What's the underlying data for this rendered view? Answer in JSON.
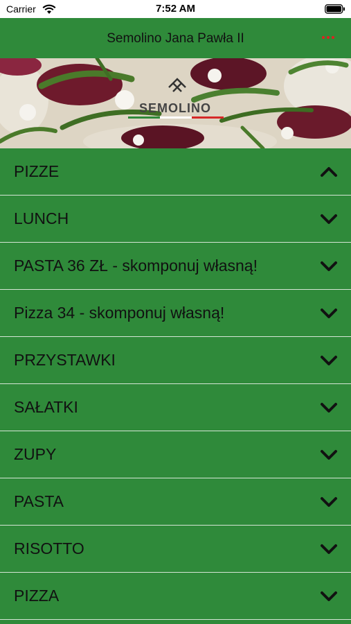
{
  "status_bar": {
    "carrier": "Carrier",
    "time": "7:52 AM"
  },
  "nav": {
    "title": "Semolino Jana Pawła II",
    "more_icon": "ellipsis-icon",
    "more_color": "#e02020"
  },
  "hero": {
    "logo_text": "SEMOLINO"
  },
  "menu": {
    "items": [
      {
        "label": "PIZZE",
        "expanded": true
      },
      {
        "label": "LUNCH",
        "expanded": false
      },
      {
        "label": "PASTA 36 ZŁ - skomponuj własną!",
        "expanded": false
      },
      {
        "label": "Pizza 34 - skomponuj własną!",
        "expanded": false
      },
      {
        "label": "PRZYSTAWKI",
        "expanded": false
      },
      {
        "label": "SAŁATKI",
        "expanded": false
      },
      {
        "label": "ZUPY",
        "expanded": false
      },
      {
        "label": "PASTA",
        "expanded": false
      },
      {
        "label": "RISOTTO",
        "expanded": false
      },
      {
        "label": "PIZZA",
        "expanded": false
      }
    ]
  },
  "colors": {
    "brand_green": "#2f8a3a",
    "divider": "#d6e6d6",
    "accent_red": "#e02020"
  }
}
